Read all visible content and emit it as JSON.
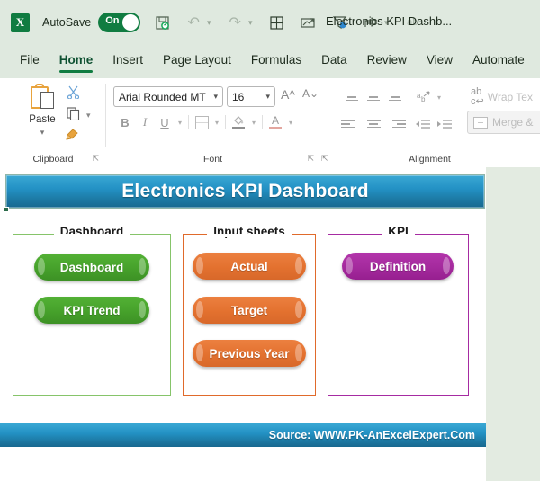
{
  "titlebar": {
    "app_logo": "excel-logo",
    "logo_letter": "X",
    "autosave_label": "AutoSave",
    "autosave_state": "On",
    "document_title": "Electronics KPI Dashb...",
    "quick_access": [
      {
        "name": "save-icon",
        "glyph": "❐"
      },
      {
        "name": "undo-icon",
        "glyph": "↶"
      },
      {
        "name": "redo-icon",
        "glyph": "↷"
      },
      {
        "name": "table-icon",
        "glyph": "⊞"
      },
      {
        "name": "insert-chart-icon",
        "glyph": "↗"
      },
      {
        "name": "filter-icon",
        "glyph": "▽"
      },
      {
        "name": "share-icon",
        "glyph": "➦"
      },
      {
        "name": "spelling-icon",
        "glyph": "ab"
      },
      {
        "name": "customize-toolbar-icon",
        "glyph": "⌵"
      }
    ]
  },
  "ribbon": {
    "tabs": [
      {
        "label": "File",
        "active": false
      },
      {
        "label": "Home",
        "active": true
      },
      {
        "label": "Insert",
        "active": false
      },
      {
        "label": "Page Layout",
        "active": false
      },
      {
        "label": "Formulas",
        "active": false
      },
      {
        "label": "Data",
        "active": false
      },
      {
        "label": "Review",
        "active": false
      },
      {
        "label": "View",
        "active": false
      },
      {
        "label": "Automate",
        "active": false
      }
    ],
    "clipboard": {
      "group_label": "Clipboard",
      "paste_label": "Paste",
      "cut_icon": "✂",
      "copy_icon": "❐",
      "format_painter_icon": "✐"
    },
    "font": {
      "group_label": "Font",
      "font_name": "Arial Rounded MT",
      "font_size": "16",
      "bold": "B",
      "italic": "I",
      "underline": "U",
      "grow_font": "A",
      "shrink_font": "A",
      "fill_color": "▣",
      "font_color": "A"
    },
    "alignment": {
      "group_label": "Alignment",
      "wrap_text_label": "Wrap Tex",
      "merge_center_label": "Merge &",
      "orientation_icon": "↗"
    }
  },
  "worksheet": {
    "banner_title": "Electronics KPI Dashboard",
    "banner_color": "#2391c4",
    "footer_source": "Source: WWW.PK-AnExcelExpert.Com",
    "panels": [
      {
        "title": "Dashboard",
        "color": "#86c46a",
        "buttons": [
          {
            "label": "Dashboard"
          },
          {
            "label": "KPI Trend"
          }
        ]
      },
      {
        "title": "Input sheets",
        "color": "#e06a2b",
        "buttons": [
          {
            "label": "Actual"
          },
          {
            "label": "Target"
          },
          {
            "label": "Previous Year"
          }
        ]
      },
      {
        "title": "KPI",
        "color": "#a62ba2",
        "buttons": [
          {
            "label": "Definition"
          }
        ]
      }
    ]
  }
}
